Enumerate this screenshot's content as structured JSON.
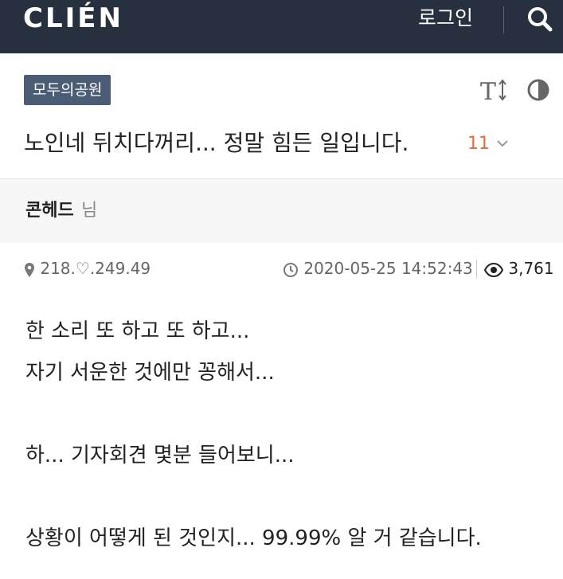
{
  "header": {
    "logo": "CLIÉN",
    "login_label": "로그인",
    "search_icon": "search-icon"
  },
  "post": {
    "board_label": "모두의공원",
    "title": "노인네 뒤치다꺼리... 정말 힘든 일입니다.",
    "comment_count": "11",
    "author": "콘헤드",
    "author_suffix": "님",
    "ip": "218.♡.249.49",
    "datetime": "2020-05-25 14:52:43",
    "views": "3,761",
    "body": [
      "한 소리 또 하고 또 하고...",
      "자기 서운한 것에만 꽁해서...",
      "",
      "하... 기자회견 몇분 들어보니...",
      "",
      "상황이 어떻게 된 것인지... 99.99% 알 거 같습니다."
    ]
  },
  "colors": {
    "topbar": "#27303f",
    "badge": "#4b5c75",
    "comment_count": "#e8683c"
  }
}
